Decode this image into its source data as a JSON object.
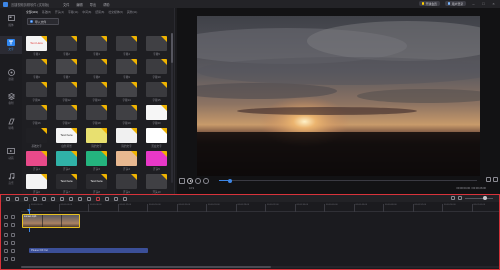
{
  "app": {
    "title": "迅捷视频剪辑软件 (试用版)",
    "menus": [
      "文件",
      "编辑",
      "导出",
      "帮助"
    ],
    "buttons": [
      "开通会员",
      "用户登录"
    ]
  },
  "sidebar": {
    "items": [
      {
        "label": "媒体",
        "icon": "media-icon"
      },
      {
        "label": "文字",
        "icon": "text-icon"
      },
      {
        "label": "滤镜",
        "icon": "filter-icon"
      },
      {
        "label": "叠附",
        "icon": "overlay-icon"
      },
      {
        "label": "转场",
        "icon": "transition-icon"
      },
      {
        "label": "动画",
        "icon": "animation-icon"
      },
      {
        "label": "音乐",
        "icon": "music-icon"
      }
    ],
    "active_index": 1
  },
  "library": {
    "tabs": [
      "全部(119)",
      "基础(8)",
      "开头(4)",
      "字幕(11)",
      "中间(8)",
      "结尾(8)",
      "社交媒体(6)",
      "其他(11)"
    ],
    "import_label": "导入文件",
    "items": [
      {
        "label": "Text Here",
        "name": "字幕1"
      },
      {
        "label": "",
        "name": "字幕2"
      },
      {
        "label": "",
        "name": "字幕3"
      },
      {
        "label": "",
        "name": "字幕4"
      },
      {
        "label": "",
        "name": "字幕5"
      },
      {
        "label": "",
        "name": "字幕6"
      },
      {
        "label": "",
        "name": "字幕7"
      },
      {
        "label": "",
        "name": "字幕8"
      },
      {
        "label": "",
        "name": "字幕9"
      },
      {
        "label": "",
        "name": "字幕10"
      },
      {
        "label": "",
        "name": "字幕11"
      },
      {
        "label": "",
        "name": "字幕12"
      },
      {
        "label": "",
        "name": "字幕13"
      },
      {
        "label": "",
        "name": "字幕14"
      },
      {
        "label": "",
        "name": "字幕15"
      },
      {
        "label": "",
        "name": "字幕16"
      },
      {
        "label": "",
        "name": "字幕17"
      },
      {
        "label": "",
        "name": "字幕18"
      },
      {
        "label": "",
        "name": "字幕19"
      },
      {
        "label": "",
        "name": "字幕20"
      },
      {
        "label": "",
        "name": "基础文字"
      },
      {
        "label": "Text here",
        "name": "白色背景"
      },
      {
        "label": "",
        "name": "简约文字"
      },
      {
        "label": "",
        "name": "简约文字"
      },
      {
        "label": "",
        "name": "黑白文字"
      },
      {
        "label": "",
        "name": "开头1"
      },
      {
        "label": "",
        "name": "开头2"
      },
      {
        "label": "",
        "name": "开头3"
      },
      {
        "label": "",
        "name": "开头4"
      },
      {
        "label": "",
        "name": "开头5"
      },
      {
        "label": "",
        "name": "开头6"
      },
      {
        "label": "Text here",
        "name": "开头7"
      },
      {
        "label": "Text here",
        "name": "开头8"
      },
      {
        "label": "",
        "name": "开头9"
      },
      {
        "label": "",
        "name": "开头10"
      }
    ]
  },
  "preview": {
    "ratio": "16:9",
    "timecode": "00:00:00.00 / 00:00:28.00",
    "progress": 0.04
  },
  "timeline": {
    "ruler": [
      "00:00:00:00",
      "00:00:04:00",
      "00:00:08:00",
      "00:00:12:00",
      "00:00:16:00",
      "00:00:20:00",
      "00:00:24:00",
      "00:00:28:00",
      "00:00:32:00",
      "00:00:36:00",
      "00:00:40:00",
      "00:00:44:00",
      "00:00:48:00",
      "00:00:52:00",
      "00:00:56:00",
      "00:01:00:00"
    ],
    "video_clip": "sunset.mp4",
    "text_clip": "Please Fill Out"
  }
}
